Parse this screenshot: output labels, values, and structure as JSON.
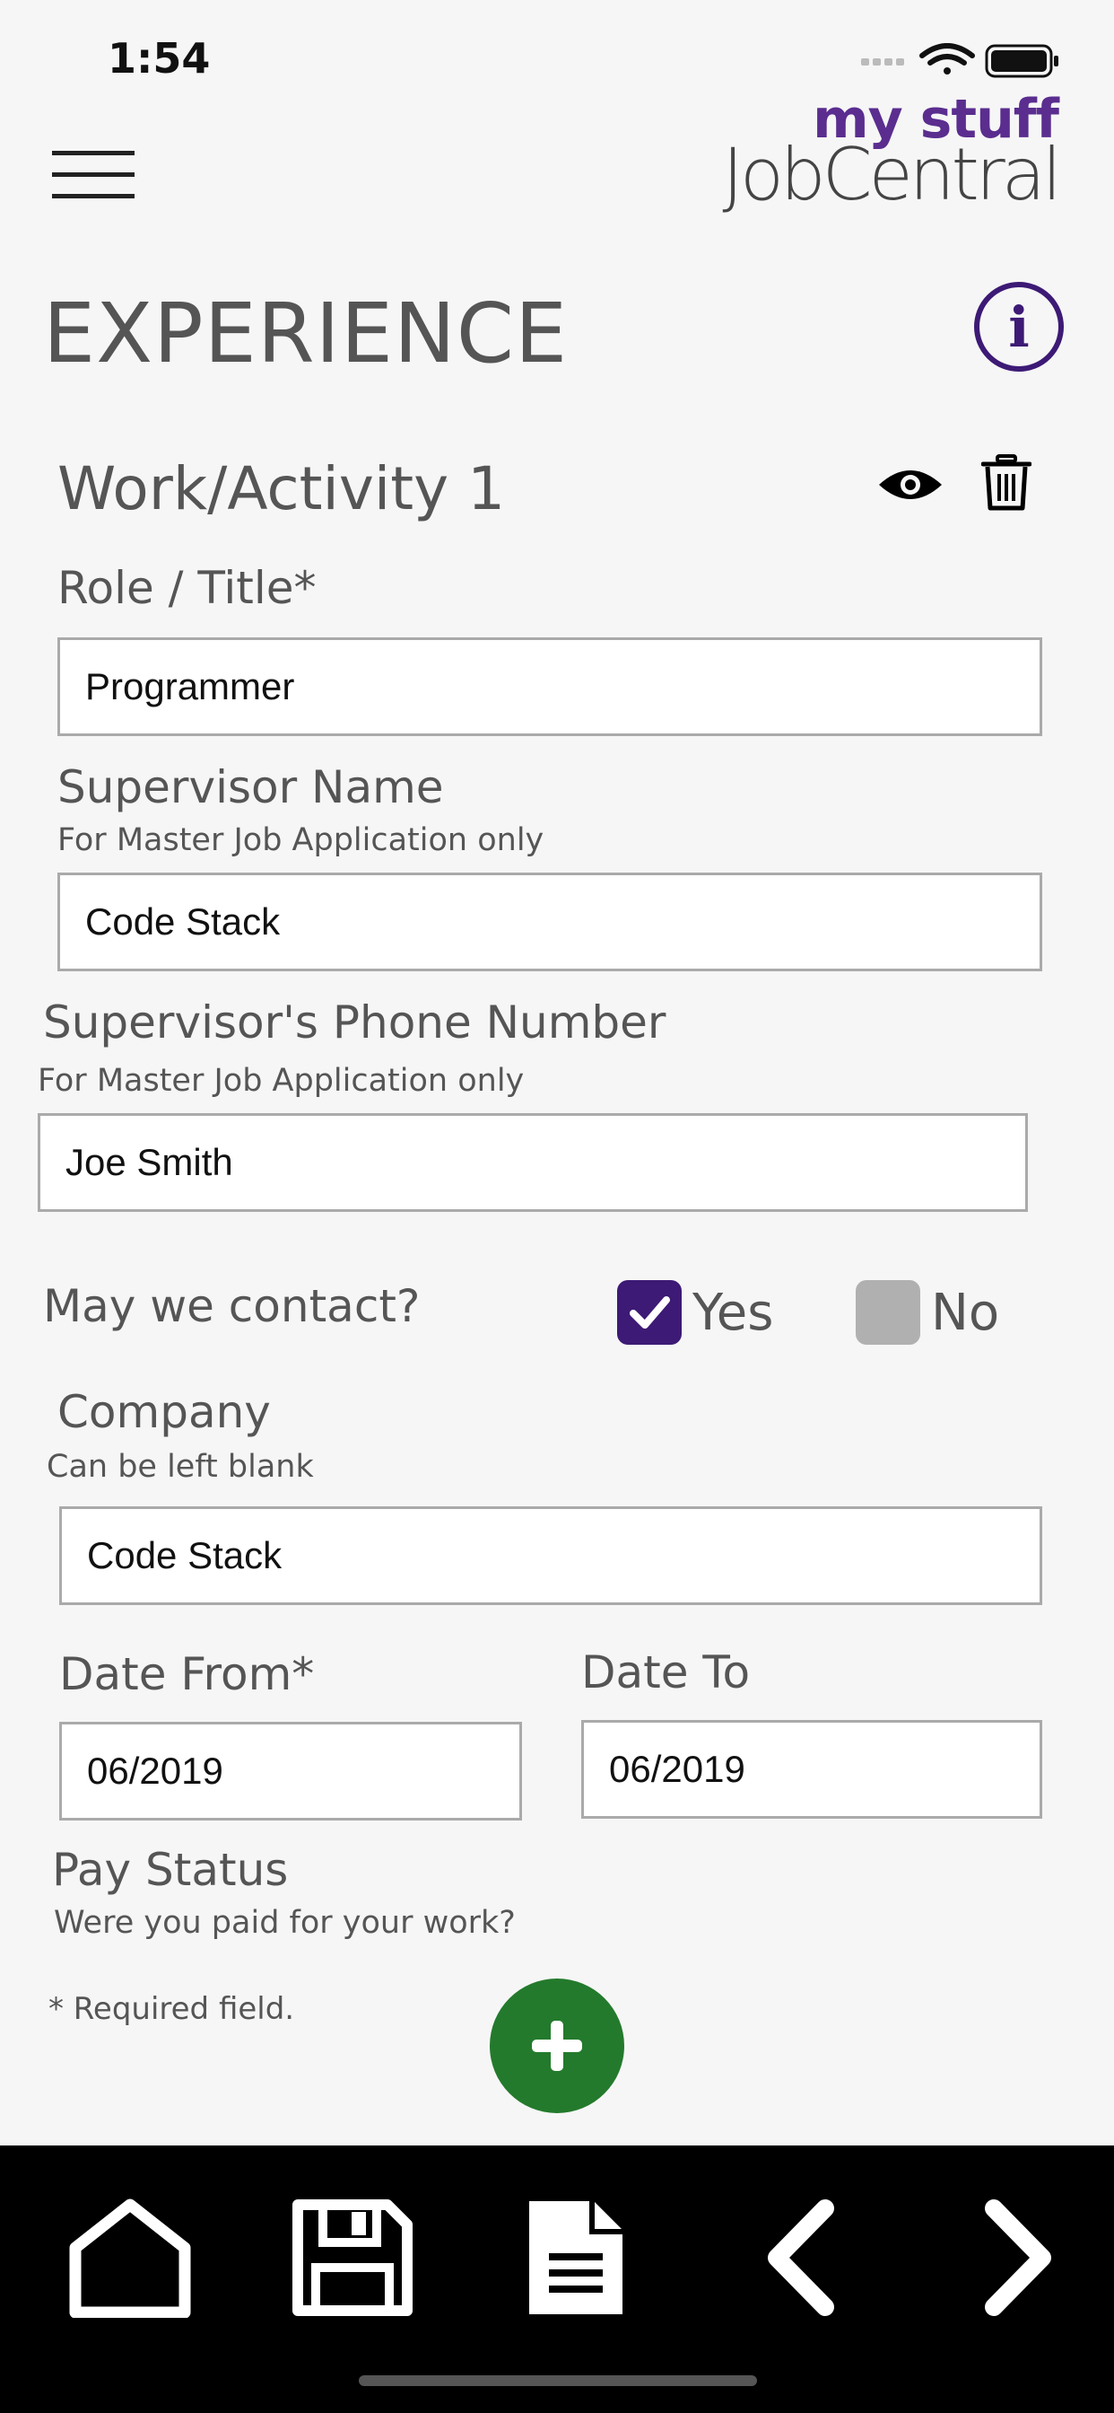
{
  "status_bar": {
    "time": "1:54"
  },
  "header": {
    "logo_line1": "my stuff",
    "logo_line2": "JobCentral"
  },
  "page": {
    "title": "EXPERIENCE"
  },
  "section": {
    "title": "Work/Activity 1"
  },
  "form": {
    "role": {
      "label": "Role / Title*",
      "value": "Programmer"
    },
    "supervisor_name": {
      "label": "Supervisor Name",
      "hint": "For Master Job Application only",
      "value": "Code Stack"
    },
    "supervisor_phone": {
      "label": "Supervisor's Phone Number",
      "hint": "For Master Job Application only",
      "value": "Joe Smith"
    },
    "contact": {
      "label": "May we contact?",
      "yes_label": "Yes",
      "no_label": "No",
      "selected": "Yes"
    },
    "company": {
      "label": "Company",
      "hint": "Can be left blank",
      "value": "Code Stack"
    },
    "date_from": {
      "label": "Date From*",
      "value": "06/2019"
    },
    "date_to": {
      "label": "Date To",
      "value": "06/2019"
    },
    "pay_status": {
      "label": "Pay Status",
      "hint": "Were you paid for your work?"
    },
    "required_note": "* Required field."
  },
  "colors": {
    "brand_purple": "#3d1a75",
    "add_green": "#237a2c",
    "bottom_bar": "#000000"
  },
  "bottom_nav": [
    "home-icon",
    "save-icon",
    "document-icon",
    "back-icon",
    "forward-icon"
  ]
}
